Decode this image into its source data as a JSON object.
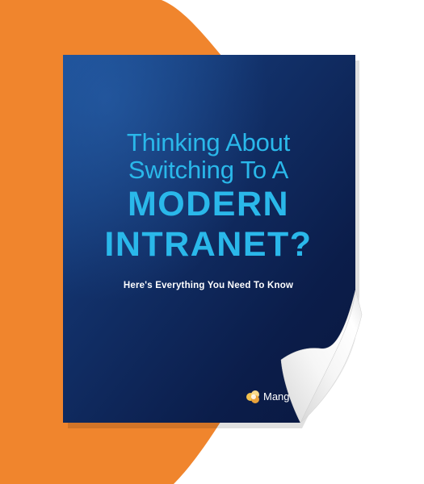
{
  "cover": {
    "title_line1": "Thinking About",
    "title_line2": "Switching To A",
    "title_line3": "MODERN",
    "title_line4": "INTRANET?",
    "subtitle": "Here's Everything You Need To Know",
    "logo_text": "Mang"
  },
  "colors": {
    "orange": "#f0852d",
    "navy_dark": "#0b1b45",
    "navy_light": "#1a4a8e",
    "title_accent": "#2ab8ea",
    "subtitle": "#ffffff"
  },
  "icons": {
    "logo": "flower-logo-icon"
  }
}
